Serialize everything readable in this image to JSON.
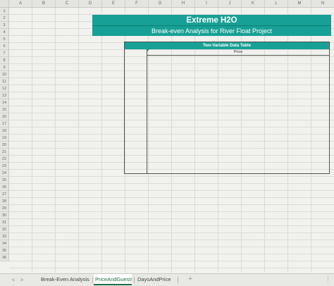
{
  "columns": [
    "A",
    "B",
    "C",
    "D",
    "E",
    "F",
    "G",
    "H",
    "I",
    "J",
    "K",
    "L",
    "M",
    "N"
  ],
  "rows": [
    "1",
    "2",
    "3",
    "4",
    "5",
    "6",
    "7",
    "8",
    "9",
    "10",
    "11",
    "12",
    "13",
    "14",
    "15",
    "16",
    "17",
    "18",
    "19",
    "20",
    "21",
    "22",
    "23",
    "24",
    "25",
    "26",
    "27",
    "28",
    "29",
    "30",
    "31",
    "32",
    "33",
    "34",
    "35",
    "36"
  ],
  "title": "Extreme H2O",
  "subtitle": "Break-even Analysis for River Float Project",
  "data_table": {
    "header": "Two-Variable Data Table",
    "column_label": "Price"
  },
  "tabs": [
    {
      "label": "Break-Even Analysis",
      "active": false
    },
    {
      "label": "PriceAndGuests",
      "active": true
    },
    {
      "label": "DaysAndPrice",
      "active": false
    }
  ],
  "nav": {
    "prev": "<",
    "next": ">"
  },
  "add_sheet": "+",
  "menu": "⋮",
  "colors": {
    "accent": "#17a095",
    "active_tab": "#1f6f42"
  }
}
